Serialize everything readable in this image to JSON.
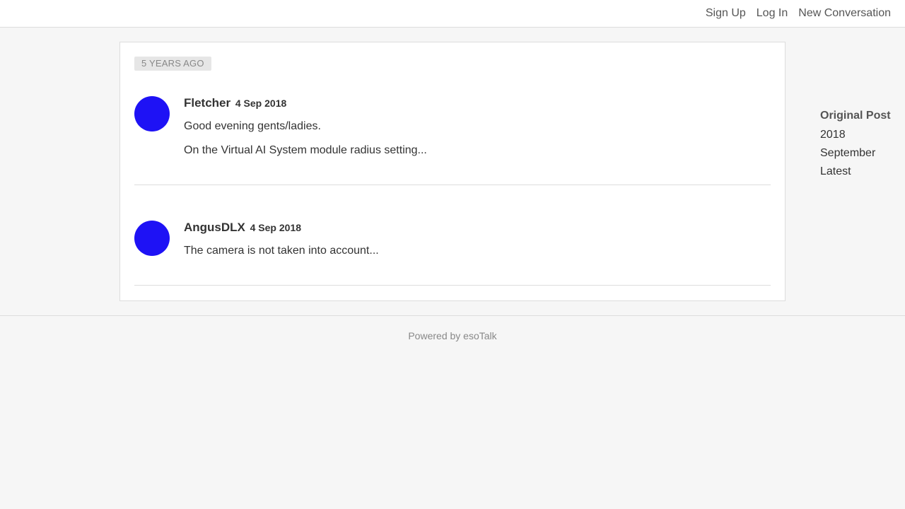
{
  "header": {
    "nav": {
      "sign_up": "Sign Up",
      "log_in": "Log In",
      "new_conversation": "New Conversation"
    }
  },
  "conversation": {
    "time_marker": "5 YEARS AGO",
    "posts": [
      {
        "author": "Fletcher",
        "date": "4 Sep 2018",
        "lines": [
          "Good evening gents/ladies.",
          "On the Virtual AI System module radius setting..."
        ],
        "avatar_color": "#1e12f5"
      },
      {
        "author": "AngusDLX",
        "date": "4 Sep 2018",
        "lines": [
          "The camera is not taken into account..."
        ],
        "avatar_color": "#1e12f5"
      }
    ]
  },
  "scrubber": {
    "title": "Original Post",
    "items": [
      "2018",
      "September",
      "Latest"
    ]
  },
  "footer": {
    "text": "Powered by esoTalk"
  }
}
